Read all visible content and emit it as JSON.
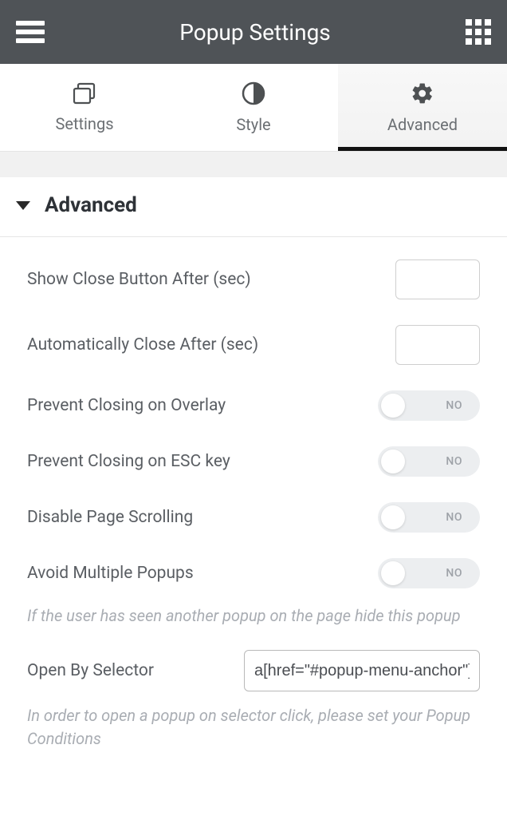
{
  "header": {
    "title": "Popup Settings"
  },
  "tabs": [
    {
      "label": "Settings"
    },
    {
      "label": "Style"
    },
    {
      "label": "Advanced"
    }
  ],
  "section": {
    "title": "Advanced"
  },
  "fields": {
    "show_close_after": {
      "label": "Show Close Button After (sec)",
      "value": ""
    },
    "auto_close_after": {
      "label": "Automatically Close After (sec)",
      "value": ""
    },
    "prevent_overlay": {
      "label": "Prevent Closing on Overlay",
      "state": "NO"
    },
    "prevent_esc": {
      "label": "Prevent Closing on ESC key",
      "state": "NO"
    },
    "disable_scroll": {
      "label": "Disable Page Scrolling",
      "state": "NO"
    },
    "avoid_multiple": {
      "label": "Avoid Multiple Popups",
      "state": "NO",
      "help": "If the user has seen another popup on the page hide this popup"
    },
    "open_by_selector": {
      "label": "Open By Selector",
      "value": "a[href=\"#popup-menu-anchor\"]",
      "help": "In order to open a popup on selector click, please set your Popup Conditions"
    }
  }
}
